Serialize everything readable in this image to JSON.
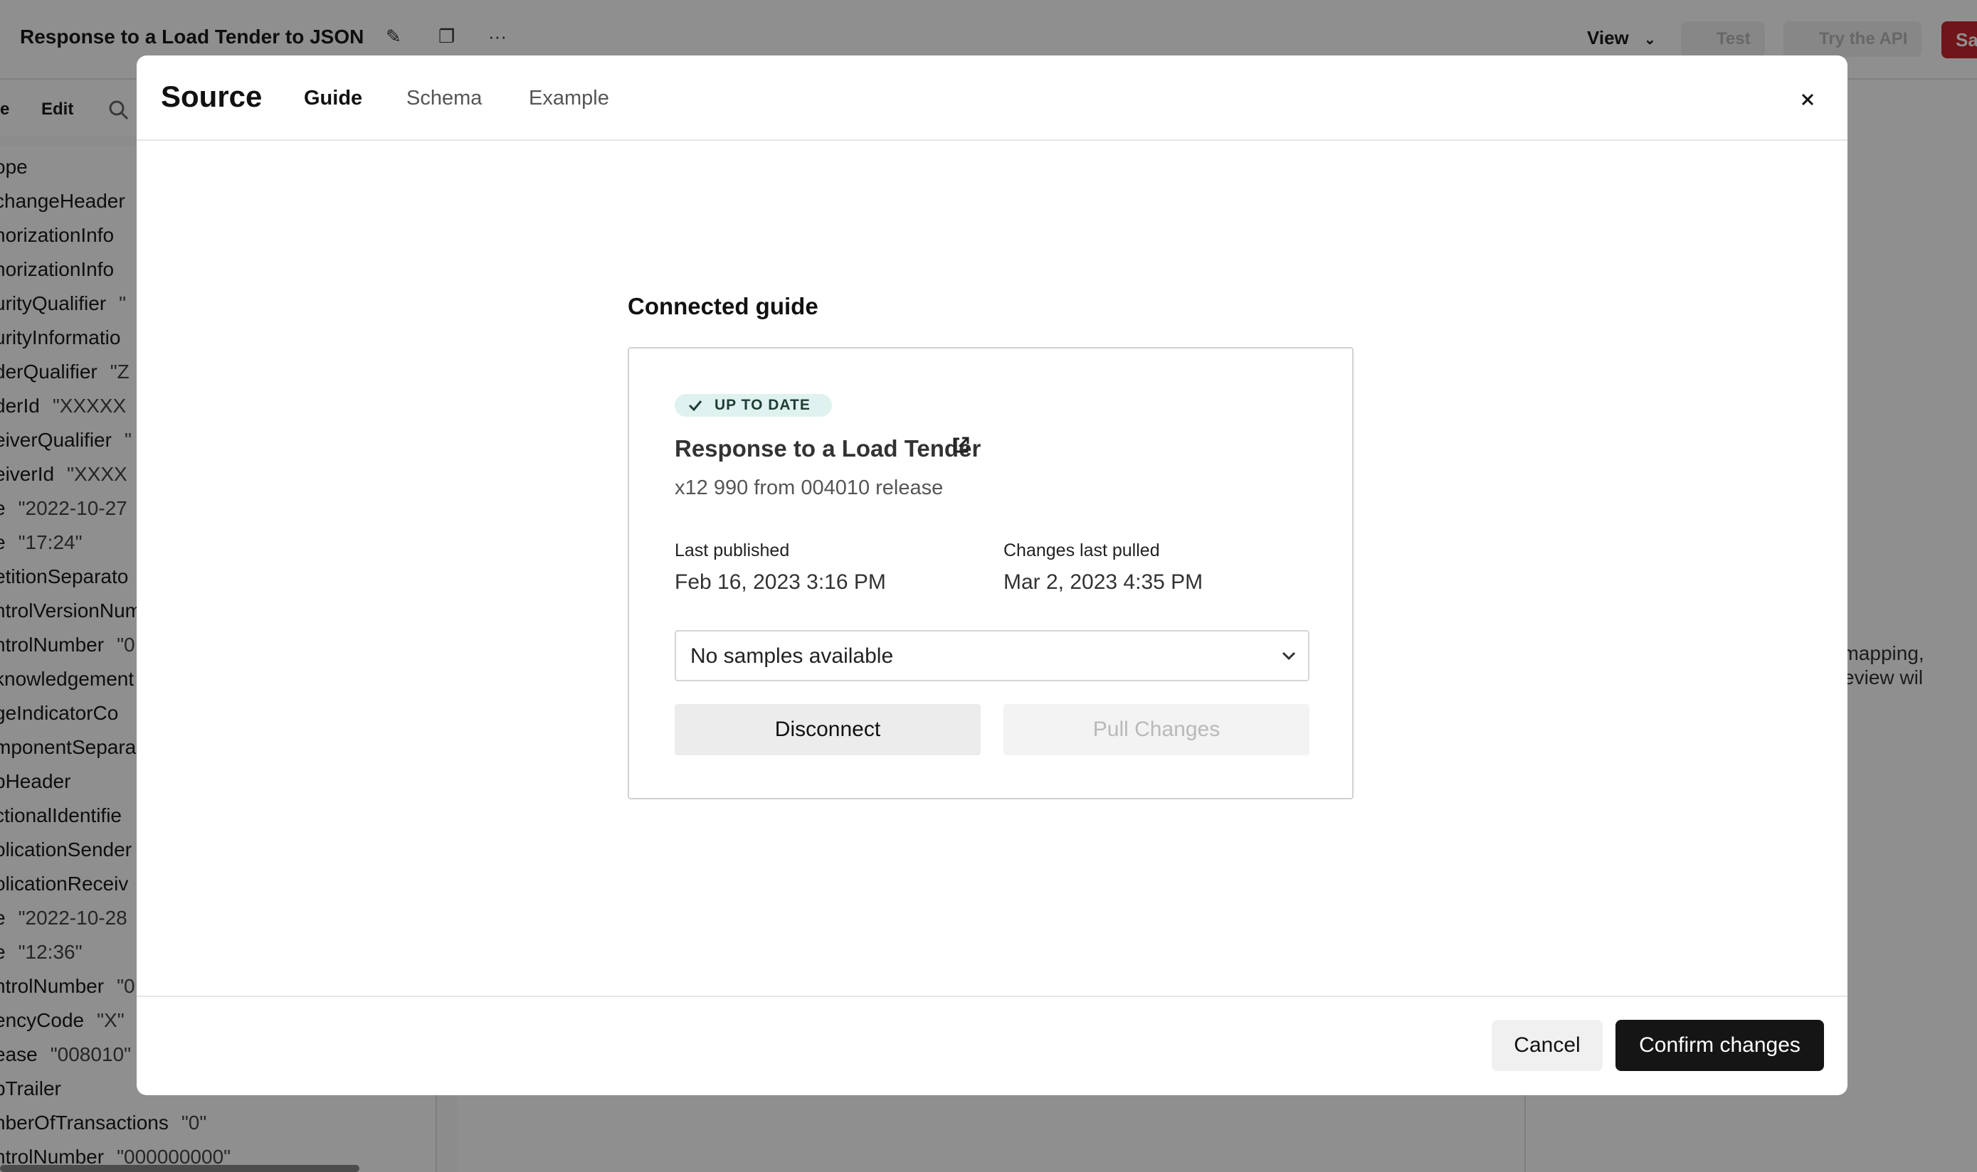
{
  "app": {
    "title": "Response to a Load Tender to JSON",
    "view_label": "View",
    "test_label": "Test",
    "try_api_label": "Try the API",
    "save_label": "Sa",
    "menu": {
      "edit_label": "Edit",
      "prev_label": "e"
    },
    "tree_rows": [
      {
        "key": "ope",
        "val": ""
      },
      {
        "key": "changeHeader",
        "val": ""
      },
      {
        "key": "horizationInfo",
        "val": ""
      },
      {
        "key": "horizationInfo",
        "val": ""
      },
      {
        "key": "urityQualifier",
        "val": "\""
      },
      {
        "key": "urityInformatio",
        "val": ""
      },
      {
        "key": "derQualifier",
        "val": "\"Z"
      },
      {
        "key": "derId",
        "val": "\"XXXXX"
      },
      {
        "key": "eiverQualifier",
        "val": "\""
      },
      {
        "key": "eiverId",
        "val": "\"XXXX"
      },
      {
        "key": "e",
        "val": "\"2022-10-27"
      },
      {
        "key": "e",
        "val": "\"17:24\""
      },
      {
        "key": "etitionSeparato",
        "val": ""
      },
      {
        "key": "ntrolVersionNum",
        "val": ""
      },
      {
        "key": "ntrolNumber",
        "val": "\"0"
      },
      {
        "key": "knowledgement",
        "val": ""
      },
      {
        "key": "geIndicatorCo",
        "val": ""
      },
      {
        "key": "mponentSepara",
        "val": ""
      },
      {
        "key": "pHeader",
        "val": ""
      },
      {
        "key": "ctionalIdentifie",
        "val": ""
      },
      {
        "key": "olicationSender",
        "val": ""
      },
      {
        "key": "olicationReceiv",
        "val": ""
      },
      {
        "key": "e",
        "val": "\"2022-10-28"
      },
      {
        "key": "e",
        "val": "\"12:36\""
      },
      {
        "key": "ntrolNumber",
        "val": "\"0"
      },
      {
        "key": "encyCode",
        "val": "\"X\""
      },
      {
        "key": "ease",
        "val": "\"008010\""
      },
      {
        "key": "pTrailer",
        "val": ""
      },
      {
        "key": "nberOfTransactions",
        "val": "\"0\""
      },
      {
        "key": "ntrolNumber",
        "val": "\"000000000\""
      }
    ],
    "right_hint_line1": "ut a mapping,",
    "right_hint_line2": "ut preview wil",
    "right_hint_line3": "."
  },
  "modal": {
    "title": "Source",
    "tabs": [
      "Guide",
      "Schema",
      "Example"
    ],
    "active_tab": "Guide",
    "section_title": "Connected guide",
    "card": {
      "status_badge": "UP TO DATE",
      "guide_name": "Response to a Load Tender",
      "guide_description": "x12 990 from 004010 release",
      "last_published_label": "Last published",
      "last_published_value": "Feb 16, 2023 3:16 PM",
      "changes_pulled_label": "Changes last pulled",
      "changes_pulled_value": "Mar 2, 2023 4:35 PM",
      "samples_select": "No samples available",
      "disconnect_label": "Disconnect",
      "pull_changes_label": "Pull Changes"
    },
    "footer": {
      "cancel_label": "Cancel",
      "confirm_label": "Confirm changes"
    }
  },
  "colors": {
    "badge_bg": "#dff2ef",
    "confirm_bg": "#151515",
    "save_bg": "#c8262d",
    "overlay": "rgba(0,0,0,0.44)"
  },
  "icons": [
    "pencil-icon",
    "copy-icon",
    "more-icon",
    "chevron-down-icon",
    "search-icon",
    "close-icon",
    "check-icon",
    "external-link-icon"
  ]
}
